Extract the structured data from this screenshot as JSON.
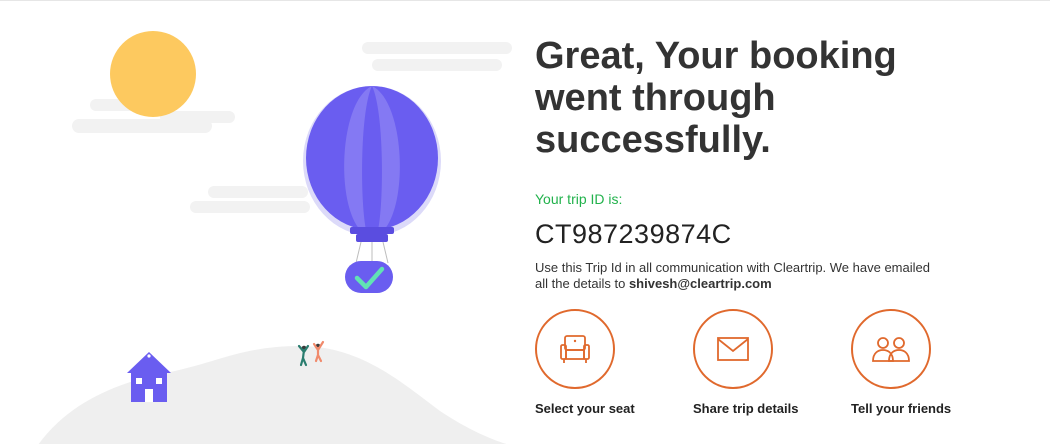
{
  "confirmation": {
    "headline": "Great, Your booking went through successfully.",
    "trip_id_label": "Your trip ID is:",
    "trip_id": "CT987239874C",
    "note_prefix": "Use this Trip Id in all communication with Cleartrip. We have emailed all the details to ",
    "email": "shivesh@cleartrip.com"
  },
  "actions": [
    {
      "label": "Select your seat",
      "icon": "seat-icon"
    },
    {
      "label": "Share trip details",
      "icon": "envelope-icon"
    },
    {
      "label": "Tell your friends",
      "icon": "people-icon"
    }
  ],
  "colors": {
    "accent": "#e0692d",
    "success": "#22b24c",
    "balloon": "#6a5df0",
    "sun": "#fdc95f",
    "hill": "#efefef",
    "text": "#333333"
  }
}
